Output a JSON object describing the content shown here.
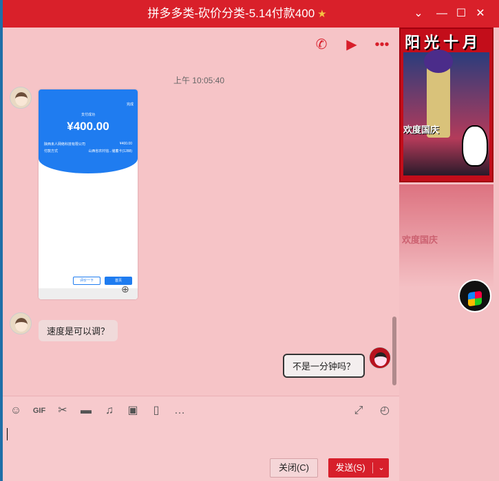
{
  "window": {
    "title": "拼多多类-砍价分类-5.14付款400",
    "title_star": "★",
    "controls": {
      "menu": "⌄",
      "minimize": "—",
      "maximize": "☐",
      "close": "✕"
    }
  },
  "chat_toolbar": {
    "icons": [
      "phone-icon",
      "video-call-icon",
      "more-icon"
    ]
  },
  "messages": {
    "timestamp": "上午 10:05:40",
    "image_message": {
      "screen_title": "支付成功",
      "screen_done": "完成",
      "amount": "¥400.00",
      "row1_label": "陕西未人网络科技有限公司",
      "row1_value": "¥400.00",
      "row2_label": "付款方式",
      "row2_value": "山西省农村信...储蓄卡(1288)",
      "btn_rate": "评价一下",
      "btn_home": "首页"
    },
    "incoming_text": "速度是可以调？",
    "outgoing_text": "不是一分钟吗？"
  },
  "input_toolbar": {
    "left_icons": [
      "emoji-icon",
      "gif-icon",
      "scissors-icon",
      "folder-icon",
      "music-icon",
      "image-icon",
      "screen-record-icon",
      "more-icon"
    ],
    "right_icons": [
      "expand-icon",
      "history-icon"
    ]
  },
  "buttons": {
    "close_label": "关闭(C)",
    "send_label": "发送(S)",
    "send_arrow": "⌄"
  },
  "sidebar": {
    "banner_title": "阳光十月",
    "banner_tag": "欢度国庆"
  }
}
